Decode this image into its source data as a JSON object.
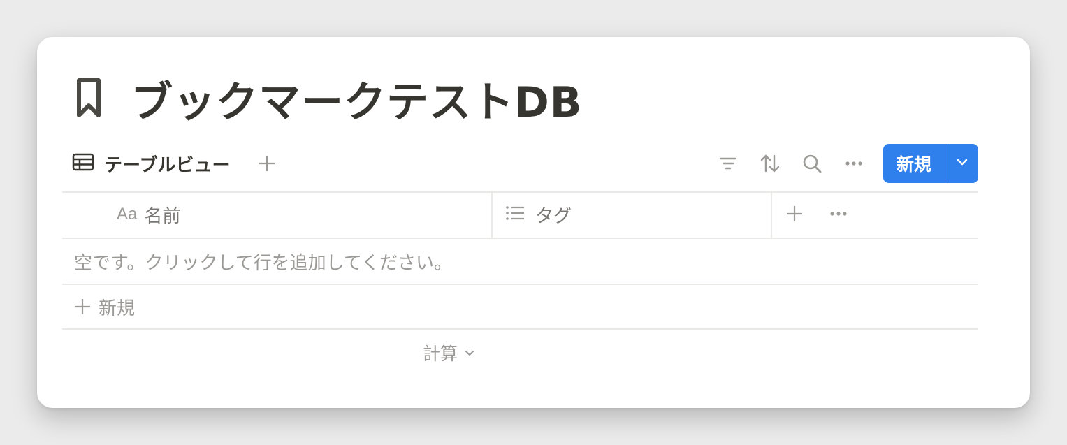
{
  "page": {
    "title": "ブックマークテストDB",
    "title_icon": "bookmark-icon"
  },
  "toolbar": {
    "view_tab_label": "テーブルビュー",
    "view_tab_icon": "table-icon",
    "add_view_icon": "plus-icon",
    "filter_icon": "filter-icon",
    "sort_icon": "sort-icon",
    "search_icon": "search-icon",
    "more_icon": "more-horizontal-icon",
    "new_button_label": "新規",
    "new_button_dropdown_icon": "chevron-down-icon"
  },
  "table": {
    "columns": [
      {
        "prefix": "Aa",
        "label": "名前",
        "type_icon": "text-type-icon"
      },
      {
        "label": "タグ",
        "type_icon": "list-type-icon"
      }
    ],
    "empty_message": "空です。クリックして行を追加してください。",
    "new_row_label": "新規",
    "calc_label": "計算"
  },
  "colors": {
    "accent": "#2f80ed",
    "text_primary": "#37352f",
    "text_secondary": "#9b9a97",
    "border": "#e9e9e7",
    "background": "#ebebeb"
  }
}
